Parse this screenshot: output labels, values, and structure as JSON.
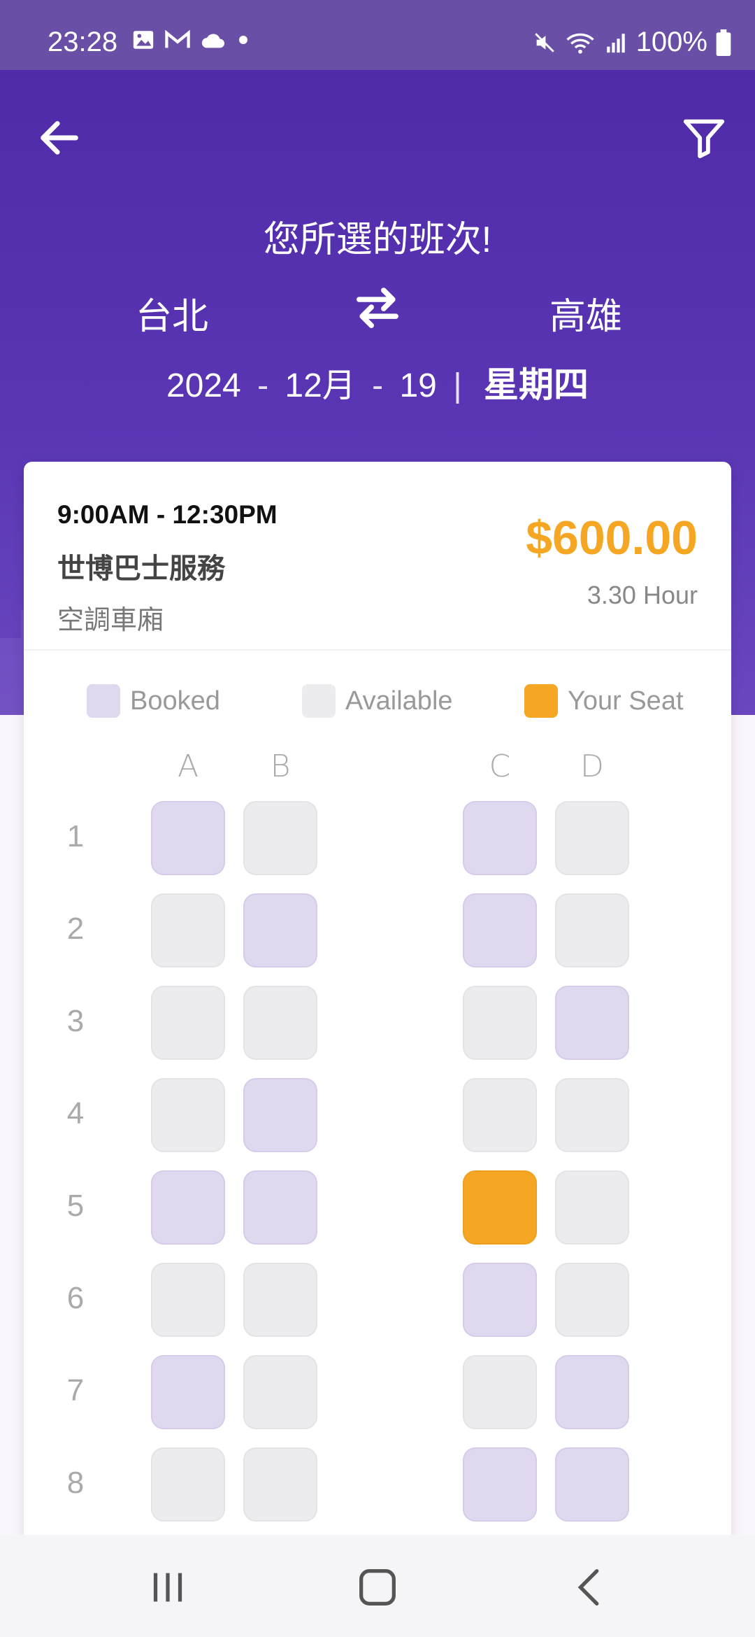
{
  "status_bar": {
    "time": "23:28",
    "battery": "100%",
    "left_icons": [
      "gallery-icon",
      "gmail-icon",
      "cloud-icon",
      "dot-icon"
    ],
    "right_icons": [
      "mute-icon",
      "wifi-icon",
      "signal-icon",
      "battery-icon"
    ]
  },
  "header": {
    "title": "您所選的班次!",
    "from": "台北",
    "to": "高雄",
    "date": {
      "year": "2024",
      "month": "12月",
      "day": "19",
      "weekday": "星期四"
    },
    "colors": {
      "primary": "#4f2ba8",
      "text": "#ffffff"
    }
  },
  "trip": {
    "time_range": "9:00AM - 12:30PM",
    "operator": "世博巴士服務",
    "cabin": "空調車廂",
    "price": "$600.00",
    "duration": "3.30 Hour",
    "price_color": "#f5a623"
  },
  "legend": [
    {
      "label": "Booked",
      "status": "booked",
      "color": "#e0d8ef"
    },
    {
      "label": "Available",
      "status": "available",
      "color": "#ecebee"
    },
    {
      "label": "Your Seat",
      "status": "mine",
      "color": "#f5a623"
    }
  ],
  "seat_map": {
    "columns": [
      "A",
      "B",
      "C",
      "D"
    ],
    "rows": [
      {
        "label": "1",
        "seats": [
          "booked",
          "available",
          "booked",
          "available"
        ]
      },
      {
        "label": "2",
        "seats": [
          "available",
          "booked",
          "booked",
          "available"
        ]
      },
      {
        "label": "3",
        "seats": [
          "available",
          "available",
          "available",
          "booked"
        ]
      },
      {
        "label": "4",
        "seats": [
          "available",
          "booked",
          "available",
          "available"
        ]
      },
      {
        "label": "5",
        "seats": [
          "booked",
          "booked",
          "mine",
          "available"
        ]
      },
      {
        "label": "6",
        "seats": [
          "available",
          "available",
          "booked",
          "available"
        ]
      },
      {
        "label": "7",
        "seats": [
          "booked",
          "available",
          "available",
          "booked"
        ]
      },
      {
        "label": "8",
        "seats": [
          "available",
          "available",
          "booked",
          "booked"
        ]
      }
    ]
  },
  "nav_bar": [
    "recent-apps-icon",
    "home-icon",
    "back-nav-icon"
  ]
}
